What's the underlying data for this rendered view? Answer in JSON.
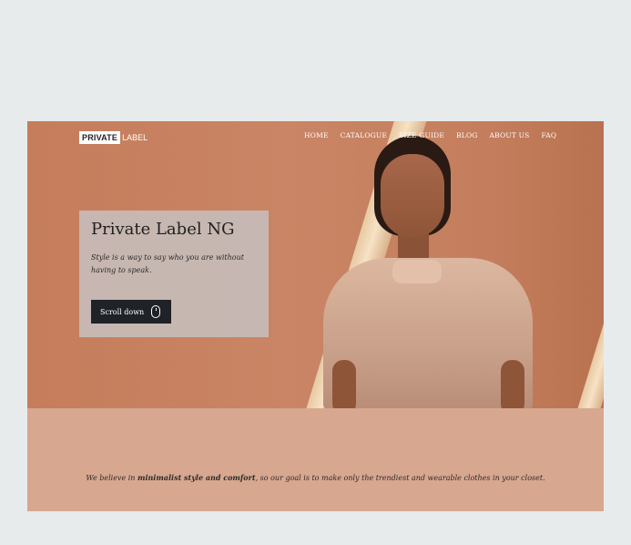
{
  "header": {
    "logo_part1": "PRIVATE",
    "logo_part2": "LABEL",
    "nav": [
      "HOME",
      "CATALOGUE",
      "SIZE GUIDE",
      "BLOG",
      "ABOUT US",
      "FAQ"
    ]
  },
  "hero": {
    "title": "Private Label NG",
    "tagline": "Style is a way to say who you are without having to speak.",
    "button_label": "Scroll down"
  },
  "about": {
    "text_before": "We believe in ",
    "text_bold": "minimalist style and comfort",
    "text_after": ", so our goal is to make only the trendiest and wearable clothes in your closet."
  },
  "colors": {
    "hero_background": "#c98565",
    "about_background": "#d8a78f",
    "button": "#1f2226"
  }
}
